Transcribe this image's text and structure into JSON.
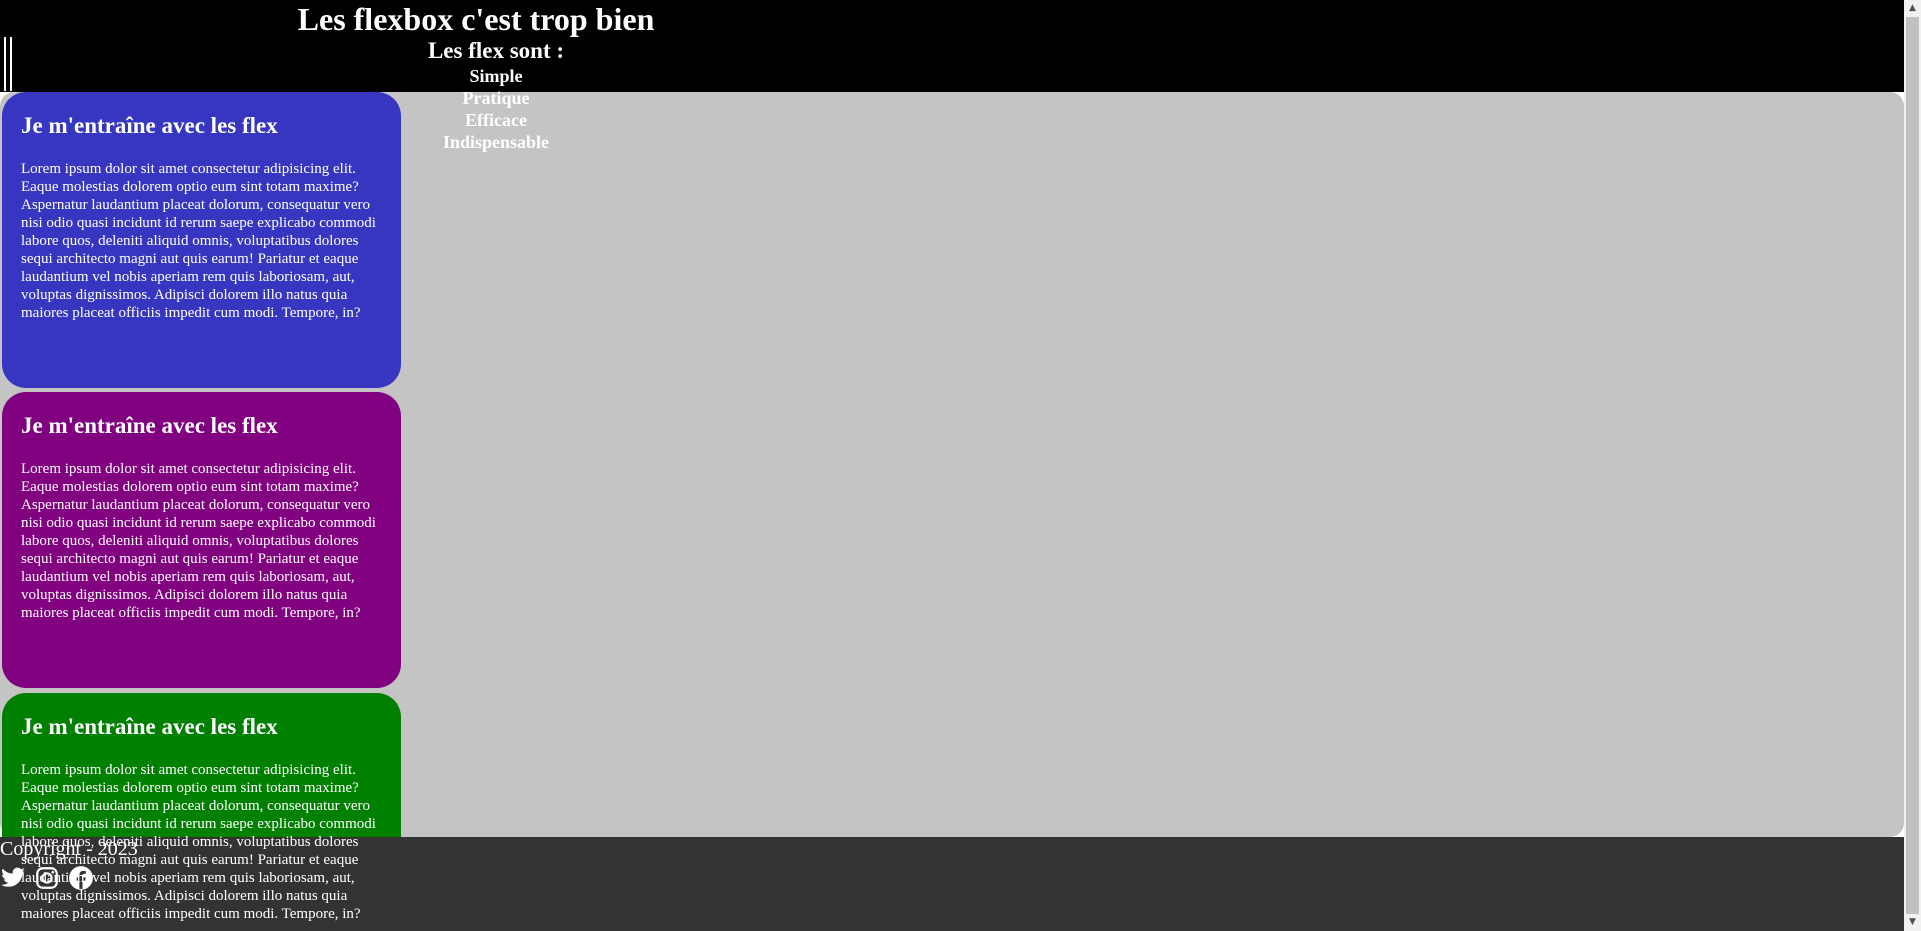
{
  "header": {
    "title": "Les flexbox c'est trop bien",
    "nav_heading": "Les flex sont :",
    "nav_items": [
      "Simple",
      "Pratique",
      "Efficace",
      "Indispensable"
    ]
  },
  "cards": [
    {
      "title": "Je m'entraîne avec les flex",
      "text": "Lorem ipsum dolor sit amet consectetur adipisicing elit. Eaque molestias dolorem optio eum sint totam maxime? Aspernatur laudantium placeat dolorum, consequatur vero nisi odio quasi incidunt id rerum saepe explicabo commodi labore quos, deleniti aliquid omnis, voluptatibus dolores sequi architecto magni aut quis earum! Pariatur et eaque laudantium vel nobis aperiam rem quis laboriosam, aut, voluptas dignissimos. Adipisci dolorem illo natus quia maiores placeat officiis impedit cum modi. Tempore, in?",
      "color": "#3636c0"
    },
    {
      "title": "Je m'entraîne avec les flex",
      "text": "Lorem ipsum dolor sit amet consectetur adipisicing elit. Eaque molestias dolorem optio eum sint totam maxime? Aspernatur laudantium placeat dolorum, consequatur vero nisi odio quasi incidunt id rerum saepe explicabo commodi labore quos, deleniti aliquid omnis, voluptatibus dolores sequi architecto magni aut quis earum! Pariatur et eaque laudantium vel nobis aperiam rem quis laboriosam, aut, voluptas dignissimos. Adipisci dolorem illo natus quia maiores placeat officiis impedit cum modi. Tempore, in?",
      "color": "#800080"
    },
    {
      "title": "Je m'entraîne avec les flex",
      "text": "Lorem ipsum dolor sit amet consectetur adipisicing elit. Eaque molestias dolorem optio eum sint totam maxime? Aspernatur laudantium placeat dolorum, consequatur vero nisi odio quasi incidunt id rerum saepe explicabo commodi labore quos, deleniti aliquid omnis, voluptatibus dolores sequi architecto magni aut quis earum! Pariatur et eaque laudantium vel nobis aperiam rem quis laboriosam, aut, voluptas dignissimos. Adipisci dolorem illo natus quia maiores placeat officiis impedit cum modi. Tempore, in?",
      "color": "#008000"
    }
  ],
  "footer": {
    "copyright": "Copyright - 2023",
    "social_icons": [
      "twitter-icon",
      "instagram-icon",
      "facebook-icon"
    ]
  },
  "colors": {
    "header_bg": "#000000",
    "main_bg": "#c4c4c4",
    "footer_bg": "#333333"
  }
}
